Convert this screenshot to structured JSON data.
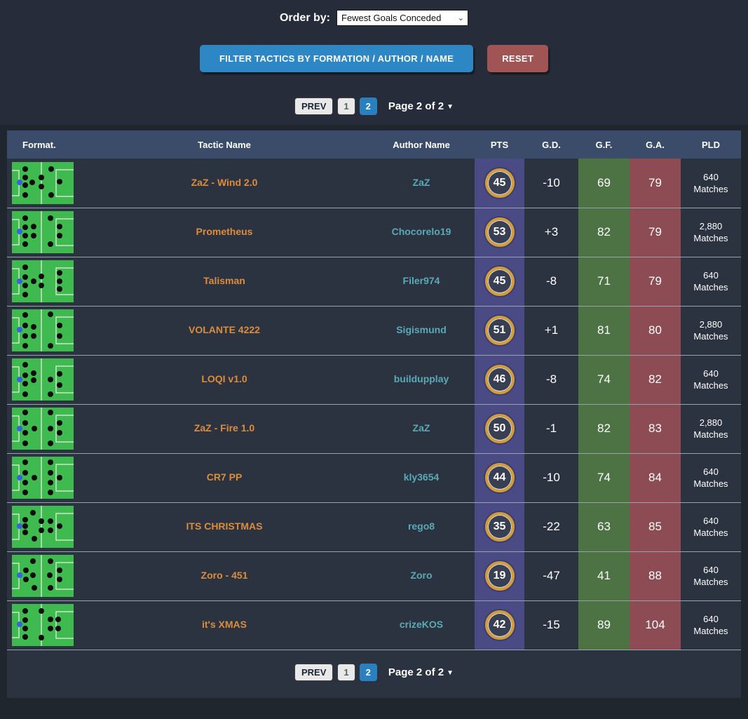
{
  "order_by": {
    "label": "Order by:",
    "value": "Fewest Goals Conceded",
    "caret": "⌄"
  },
  "buttons": {
    "filter": "FILTER TACTICS BY FORMATION / AUTHOR / NAME",
    "reset": "RESET"
  },
  "pagination": {
    "prev": "PREV",
    "page1": "1",
    "page2": "2",
    "status": "Page 2 of 2",
    "caret": "▼"
  },
  "colors": {
    "header_bg": "#3a4c69",
    "row_bg": "#2c3340",
    "pts_col": "#4a4b84",
    "gf_col": "#4d7345",
    "ga_col": "#8d4b53",
    "pitch_green": "#3fba4e",
    "pitch_line": "#d6e8d6",
    "gk_blue": "#3a62e0",
    "player_black": "#0d0d0d",
    "pts_ring_gold": "#d29e3d",
    "tactic_orange": "#dd8c3c",
    "author_teal": "#5aa9b7",
    "active_page_blue": "#2a7fbe",
    "filter_blue": "#2d87c4",
    "reset_red": "#a15454"
  },
  "table": {
    "headers": [
      "Format.",
      "Tactic Name",
      "Author Name",
      "PTS",
      "G.D.",
      "G.F.",
      "G.A.",
      "PLD"
    ],
    "pld_suffix": "Matches",
    "rows": [
      {
        "tactic": "ZaZ - Wind 2.0",
        "author": "ZaZ",
        "pts": "45",
        "gd": "-10",
        "gf": "69",
        "ga": "79",
        "pld": "640",
        "formation": {
          "gk": [
            11,
            29
          ],
          "dots": [
            [
              19,
              10
            ],
            [
              19,
              22
            ],
            [
              19,
              33
            ],
            [
              19,
              47
            ],
            [
              29,
              29
            ],
            [
              42,
              22
            ],
            [
              42,
              35
            ],
            [
              56,
              10
            ],
            [
              56,
              47
            ],
            [
              68,
              28
            ]
          ]
        }
      },
      {
        "tactic": "Prometheus",
        "author": "Chocorelo19",
        "pts": "53",
        "gd": "+3",
        "gf": "82",
        "ga": "79",
        "pld": "2,880",
        "formation": {
          "gk": [
            11,
            29
          ],
          "dots": [
            [
              19,
              10
            ],
            [
              19,
              23
            ],
            [
              19,
              35
            ],
            [
              19,
              47
            ],
            [
              31,
              22
            ],
            [
              31,
              35
            ],
            [
              55,
              10
            ],
            [
              55,
              47
            ],
            [
              68,
              22
            ],
            [
              68,
              35
            ]
          ]
        }
      },
      {
        "tactic": "Talisman",
        "author": "Filer974",
        "pts": "45",
        "gd": "-8",
        "gf": "71",
        "ga": "79",
        "pld": "640",
        "formation": {
          "gk": [
            11,
            30
          ],
          "dots": [
            [
              19,
              10
            ],
            [
              19,
              24
            ],
            [
              19,
              36
            ],
            [
              19,
              49
            ],
            [
              31,
              30
            ],
            [
              42,
              23
            ],
            [
              42,
              36
            ],
            [
              68,
              18
            ],
            [
              68,
              30
            ],
            [
              68,
              41
            ]
          ]
        }
      },
      {
        "tactic": "VOLANTE 4222",
        "author": "Sigismund",
        "pts": "51",
        "gd": "+1",
        "gf": "81",
        "ga": "80",
        "pld": "2,880",
        "formation": {
          "gk": [
            11,
            29
          ],
          "dots": [
            [
              19,
              8
            ],
            [
              19,
              23
            ],
            [
              19,
              38
            ],
            [
              19,
              52
            ],
            [
              31,
              25
            ],
            [
              31,
              38
            ],
            [
              55,
              7
            ],
            [
              55,
              52
            ],
            [
              68,
              23
            ],
            [
              68,
              38
            ]
          ]
        }
      },
      {
        "tactic": "LOQI v1.0",
        "author": "buildupplay",
        "pts": "46",
        "gd": "-8",
        "gf": "74",
        "ga": "82",
        "pld": "640",
        "formation": {
          "gk": [
            11,
            30
          ],
          "dots": [
            [
              19,
              9
            ],
            [
              19,
              24
            ],
            [
              19,
              36
            ],
            [
              19,
              51
            ],
            [
              31,
              21
            ],
            [
              31,
              31
            ],
            [
              55,
              30
            ],
            [
              55,
              51
            ],
            [
              68,
              22
            ],
            [
              68,
              38
            ]
          ]
        }
      },
      {
        "tactic": "ZaZ - Fire 1.0",
        "author": "ZaZ",
        "pts": "50",
        "gd": "-1",
        "gf": "82",
        "ga": "83",
        "pld": "2,880",
        "formation": {
          "gk": [
            11,
            30
          ],
          "dots": [
            [
              19,
              7
            ],
            [
              19,
              22
            ],
            [
              19,
              36
            ],
            [
              19,
              51
            ],
            [
              32,
              30
            ],
            [
              55,
              7
            ],
            [
              55,
              30
            ],
            [
              55,
              51
            ],
            [
              68,
              22
            ],
            [
              68,
              36
            ]
          ]
        }
      },
      {
        "tactic": "CR7 PP",
        "author": "kly3654",
        "pts": "44",
        "gd": "-10",
        "gf": "74",
        "ga": "84",
        "pld": "640",
        "formation": {
          "gk": [
            11,
            30
          ],
          "dots": [
            [
              19,
              8
            ],
            [
              19,
              23
            ],
            [
              19,
              37
            ],
            [
              19,
              51
            ],
            [
              32,
              30
            ],
            [
              55,
              8
            ],
            [
              55,
              23
            ],
            [
              55,
              37
            ],
            [
              55,
              51
            ],
            [
              68,
              30
            ]
          ]
        }
      },
      {
        "tactic": "ITS CHRISTMAS",
        "author": "rego8",
        "pts": "35",
        "gd": "-22",
        "gf": "63",
        "ga": "85",
        "pld": "640",
        "formation": {
          "gk": [
            11,
            29
          ],
          "dots": [
            [
              30,
              10
            ],
            [
              19,
              20
            ],
            [
              19,
              29
            ],
            [
              19,
              38
            ],
            [
              32,
              47
            ],
            [
              42,
              22
            ],
            [
              42,
              35
            ],
            [
              55,
              22
            ],
            [
              55,
              35
            ],
            [
              68,
              29
            ]
          ]
        }
      },
      {
        "tactic": "Zoro - 451",
        "author": "Zoro",
        "pts": "19",
        "gd": "-47",
        "gf": "41",
        "ga": "88",
        "pld": "640",
        "formation": {
          "gk": [
            11,
            29
          ],
          "dots": [
            [
              30,
              9
            ],
            [
              20,
              22
            ],
            [
              30,
              29
            ],
            [
              20,
              35
            ],
            [
              32,
              47
            ],
            [
              55,
              9
            ],
            [
              54,
              29
            ],
            [
              55,
              47
            ],
            [
              68,
              22
            ],
            [
              68,
              35
            ]
          ]
        }
      },
      {
        "tactic": "it's XMAS",
        "author": "crizeKOS",
        "pts": "42",
        "gd": "-15",
        "gf": "89",
        "ga": "104",
        "pld": "640",
        "formation": {
          "gk": [
            11,
            29
          ],
          "dots": [
            [
              19,
              10
            ],
            [
              19,
              23
            ],
            [
              19,
              35
            ],
            [
              19,
              47
            ],
            [
              42,
              10
            ],
            [
              42,
              48
            ],
            [
              55,
              22
            ],
            [
              55,
              35
            ],
            [
              66,
              22
            ],
            [
              66,
              35
            ]
          ]
        }
      }
    ]
  }
}
